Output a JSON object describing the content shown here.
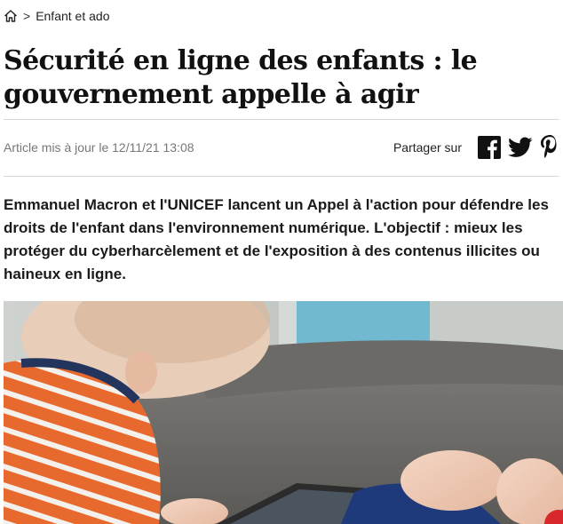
{
  "breadcrumb": {
    "home_icon": "home-icon",
    "separator": ">",
    "category": "Enfant et ado"
  },
  "article": {
    "title": "Sécurité en ligne des enfants : le gouvernement appelle à agir",
    "updated": "Article mis à jour le 12/11/21 13:08",
    "lead": "Emmanuel Macron et l'UNICEF lancent un Appel à l'action pour défendre les droits de l'enfant dans l'environnement numérique. L'objectif : mieux les protéger du cyberharcèlement et de l'exposition à des contenus illicites ou haineux en ligne."
  },
  "share": {
    "label": "Partager sur",
    "icons": [
      "facebook-icon",
      "twitter-icon",
      "pinterest-icon"
    ]
  },
  "colors": {
    "text": "#1a1a1a",
    "muted": "#777777",
    "rule": "#d9d9d9",
    "stripe_orange": "#e8692e",
    "sofa_gray": "#6f6e6c"
  }
}
